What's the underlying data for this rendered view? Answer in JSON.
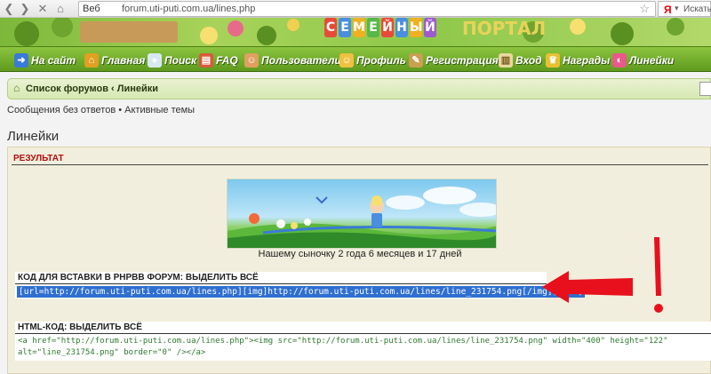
{
  "browser": {
    "url_prefix": "Веб",
    "url": "forum.uti-puti.com.ua/lines.php",
    "search_placeholder": "Искать"
  },
  "banner": {
    "logo_letters": [
      "С",
      "Е",
      "М",
      "Е",
      "Й",
      "Н",
      "Ы",
      "Й"
    ],
    "logo_colors": [
      "#e84a3a",
      "#4a8ee0",
      "#f0b020",
      "#58b848",
      "#e84a3a",
      "#4a8ee0",
      "#f0b020",
      "#a05ad0"
    ],
    "logo_second": "ПОРТАЛ"
  },
  "nav": {
    "items": [
      {
        "label": "На сайт",
        "icon": "arrow-icon",
        "icon_glyph": "➜",
        "color": "#3a7ad8"
      },
      {
        "label": "Главная",
        "icon": "home-icon",
        "icon_glyph": "⌂",
        "color": "#e0a020"
      },
      {
        "label": "Поиск",
        "icon": "balloon-icon",
        "icon_glyph": "●",
        "color": "#d8e8f0"
      },
      {
        "label": "FAQ",
        "icon": "book-icon",
        "icon_glyph": "▤",
        "color": "#d85a3a"
      },
      {
        "label": "Пользователи",
        "icon": "users-icon",
        "icon_glyph": "☺",
        "color": "#e0a060"
      },
      {
        "label": "Профиль",
        "icon": "profile-icon",
        "icon_glyph": "☺",
        "color": "#f0c040"
      },
      {
        "label": "Регистрация",
        "icon": "register-icon",
        "icon_glyph": "✎",
        "color": "#c8a050"
      },
      {
        "label": "Вход",
        "icon": "door-icon",
        "icon_glyph": "▥",
        "color": "#e8d8a0"
      },
      {
        "label": "Награды",
        "icon": "trophy-icon",
        "icon_glyph": "♛",
        "color": "#e8c030"
      },
      {
        "label": "Линейки",
        "icon": "rainbow-icon",
        "icon_glyph": "◐",
        "color": "#e85a8a"
      }
    ]
  },
  "breadcrumb": {
    "text": "Список форумов ‹ Линейки"
  },
  "quick_links": {
    "text": "Сообщения без ответов • Активные темы"
  },
  "page": {
    "title": "Линейки"
  },
  "result": {
    "title": "РЕЗУЛЬТАТ",
    "caption": "Нашему сыночку 2 года 6 месяцев и 17 дней"
  },
  "bbcode": {
    "label": "КОД ДЛЯ ВСТАВКИ В PHPBB ФОРУМ: ВЫДЕЛИТЬ ВСЁ",
    "code": "[url=http://forum.uti-puti.com.ua/lines.php][img]http://forum.uti-puti.com.ua/lines/line_231754.png[/img][/url]"
  },
  "htmlcode": {
    "label": "HTML-КОД: ВЫДЕЛИТЬ ВСЁ",
    "code": "<a href=\"http://forum.uti-puti.com.ua/lines.php\"><img src=\"http://forum.uti-puti.com.ua/lines/line_231754.png\" width=\"400\" height=\"122\" alt=\"line_231754.png\" border=\"0\" /></a>"
  },
  "annotation": {
    "mark": "!",
    "color": "#e8101c"
  }
}
